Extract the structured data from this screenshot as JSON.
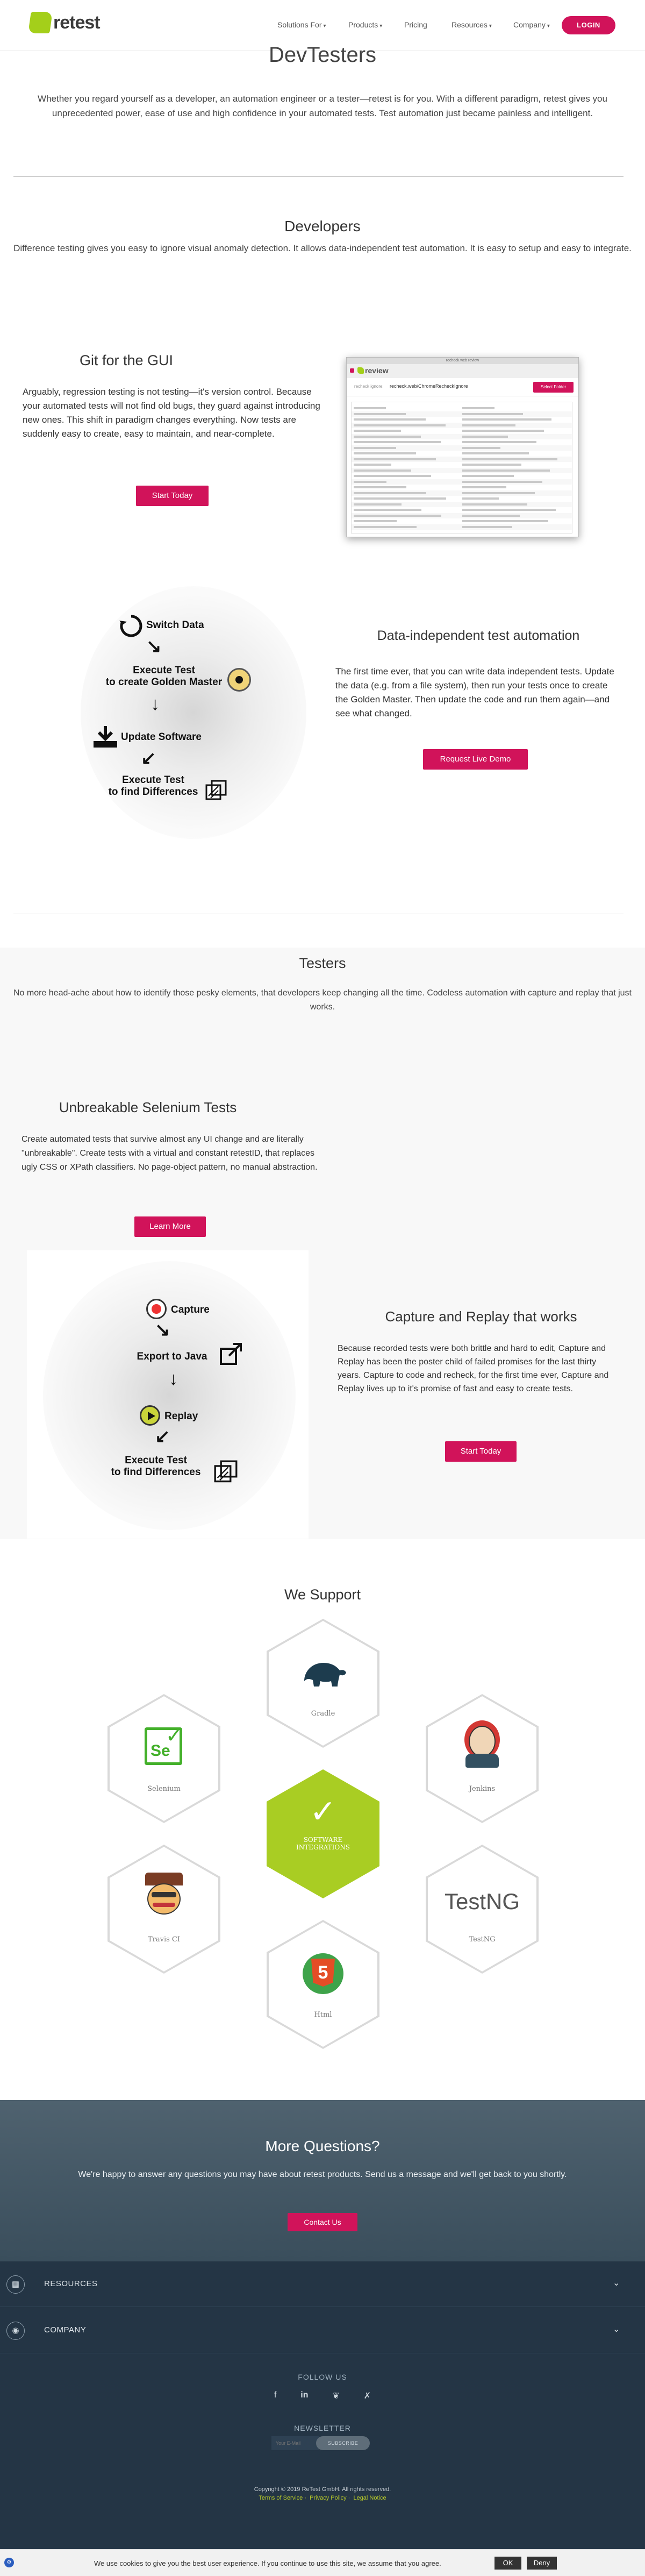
{
  "nav": {
    "logo_text": "retest",
    "links": [
      "Solutions For",
      "Products",
      "Pricing",
      "Resources",
      "Company"
    ],
    "login_label": "LOGIN"
  },
  "hero": {
    "title": "DevTesters",
    "text": "Whether you regard yourself as a developer, an automation engineer or a tester—retest is for you. With a different paradigm, retest gives you unprecedented power, ease of use and high confidence in your automated tests. Test automation just became painless and intelligent."
  },
  "developers": {
    "title": "Developers",
    "text": "Difference testing gives you easy to ignore visual anomaly detection. It allows data-independent test automation. It is easy to setup and easy to integrate."
  },
  "git": {
    "title": "Git for the GUI",
    "text": "Arguably, regression testing is not testing—it's version control. Because your automated tests will not find old bugs, they guard against introducing new ones. This shift in paradigm changes everything. Now tests are suddenly easy to create, easy to maintain, and near-complete.",
    "button": "Start Today",
    "screenshot": {
      "window_title": "recheck.web review",
      "app_name": "review",
      "path_label": "recheck ignore:",
      "path_value": "recheck.web/ChromeRecheckIgnore",
      "button": "Select Folder"
    }
  },
  "data_independent": {
    "title": "Data-independent test automation",
    "text": "The first time ever, that you can write data independent tests. Update the data (e.g. from a file system), then run your tests once to create the Golden Master. Then update the code and run them again—and see what changed.",
    "button": "Request Live Demo",
    "flow": [
      "Switch Data",
      "Execute Test\nto create Golden Master",
      "Update Software",
      "Execute Test\nto find Differences"
    ]
  },
  "testers": {
    "title": "Testers",
    "text": "No more head-ache about how to identify those pesky elements, that developers keep changing all the time. Codeless automation with capture and replay that just works."
  },
  "selenium": {
    "title": "Unbreakable Selenium Tests",
    "text": "Create automated tests that survive almost any UI change and are literally \"unbreakable\". Create tests with a virtual and constant retestID, that replaces ugly CSS or XPath classifiers. No page-object pattern, no manual abstraction.",
    "button": "Learn More"
  },
  "capture": {
    "title": "Capture and Replay that works",
    "text": "Because recorded tests were both brittle and hard to edit, Capture and Replay has been the poster child of failed promises for the last thirty years. Capture to code and recheck, for the first time ever, Capture and Replay lives up to it's promise of fast and easy to create tests.",
    "button": "Start Today",
    "flow": [
      "Capture",
      "Export to Java",
      "Replay",
      "Execute Test\nto find Differences"
    ]
  },
  "support": {
    "title": "We Support",
    "items": [
      "Gradle",
      "Selenium",
      "Jenkins",
      "SOFTWARE\nINTEGRATIONS",
      "Travis CI",
      "TestNG",
      "Html"
    ],
    "testng_text": "TestNG",
    "html_text": "5"
  },
  "contact": {
    "title": "More Questions?",
    "text": "We're happy to answer any questions you may have about retest products. Send us a message and we'll get back to you shortly.",
    "button": "Contact Us"
  },
  "footer": {
    "sections": [
      "RESOURCES",
      "COMPANY"
    ],
    "follow_us": "FOLLOW US",
    "newsletter": "NEWSLETTER",
    "email_placeholder": "Your E-Mail",
    "subscribe": "SUBSCRIBE",
    "copyright": "Copyright © 2019 ReTest GmbH. All rights reserved.",
    "legal_links": [
      "Terms of Service",
      "Privacy Policy",
      "Legal Notice"
    ]
  },
  "cookie": {
    "text": "We use cookies to give you the best user experience. If you continue to use this site, we assume that you agree.",
    "ok": "OK",
    "deny": "Deny"
  },
  "colors": {
    "accent": "#d1135a",
    "brand_green": "#a4cf1a",
    "footer": "#243545"
  }
}
